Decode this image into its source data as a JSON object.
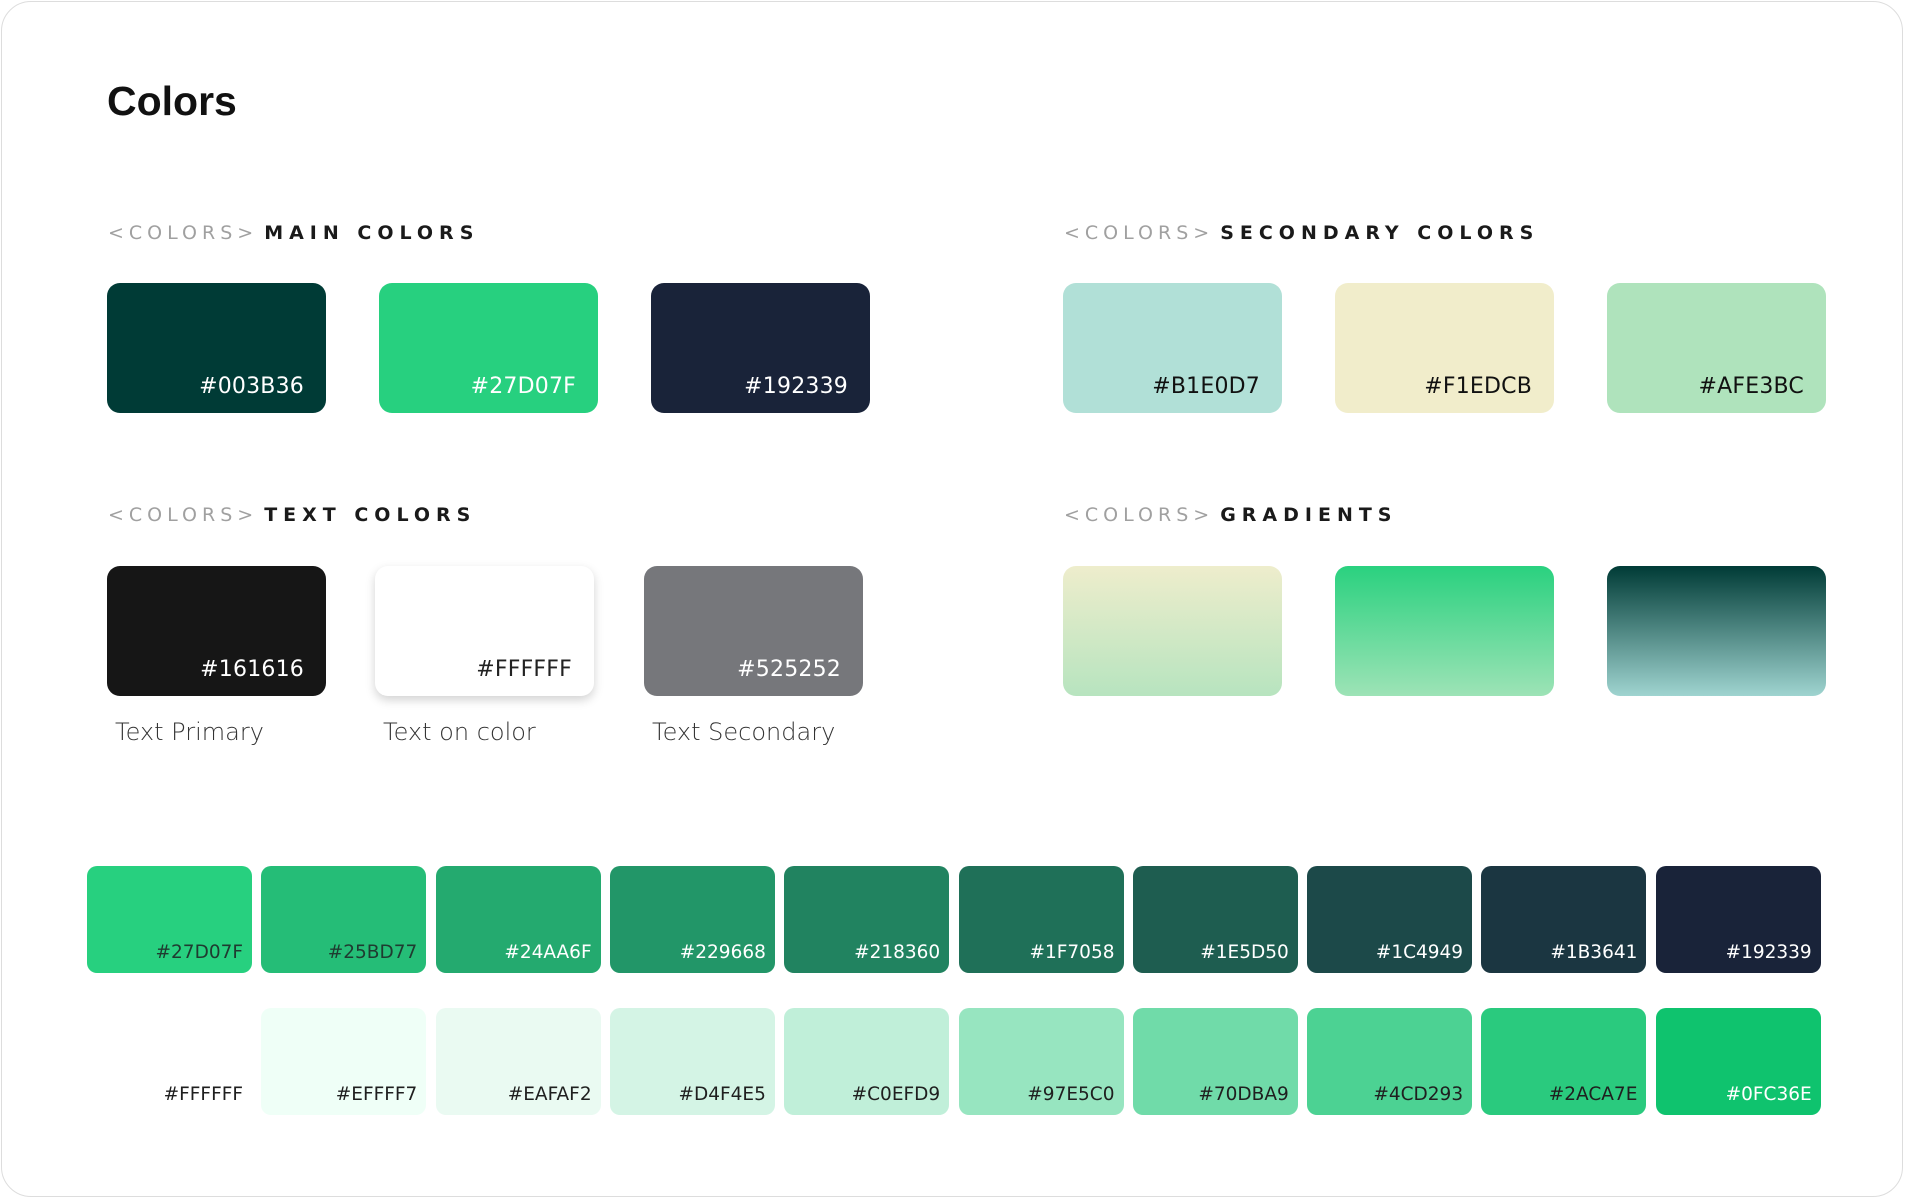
{
  "page": {
    "title": "Colors"
  },
  "main_colors": {
    "prefix": "<COLORS>",
    "title": "MAIN COLORS",
    "swatches": [
      {
        "hex": "#003B36",
        "color": "#003b36",
        "text_color": "#ffffff"
      },
      {
        "hex": "#27D07F",
        "color": "#27d07f",
        "text_color": "#ffffff"
      },
      {
        "hex": "#192339",
        "color": "#192339",
        "text_color": "#ffffff"
      }
    ]
  },
  "secondary_colors": {
    "prefix": "<COLORS>",
    "title": "SECONDARY COLORS",
    "swatches": [
      {
        "hex": "#B1E0D7",
        "color": "#b1e0d7",
        "text_color": "#111111"
      },
      {
        "hex": "#F1EDCB",
        "color": "#f1edcb",
        "text_color": "#111111"
      },
      {
        "hex": "#AFE3BC",
        "color": "#afe3bc",
        "text_color": "#111111"
      }
    ]
  },
  "text_colors": {
    "prefix": "<COLORS>",
    "title": "TEXT COLORS",
    "swatches": [
      {
        "hex": "#161616",
        "color": "#161616",
        "text_color": "#ffffff",
        "caption": "Text Primary"
      },
      {
        "hex": "#FFFFFF",
        "color": "#ffffff",
        "text_color": "#222222",
        "caption": "Text on color"
      },
      {
        "hex": "#525252",
        "color": "#76777b",
        "text_color": "#ffffff",
        "caption": "Text Secondary"
      }
    ]
  },
  "gradients": {
    "prefix": "<COLORS>",
    "title": "GRADIENTS",
    "items": [
      {
        "from": "#eeedcc",
        "to": "#b7e4bf"
      },
      {
        "from": "#2ad17f",
        "to": "#9de3b6"
      },
      {
        "from": "#003b36",
        "to": "#9fd4d0"
      }
    ]
  },
  "palette_dark": [
    {
      "hex": "#27D07F",
      "color": "#27d07f"
    },
    {
      "hex": "#25BD77",
      "color": "#25bd77"
    },
    {
      "hex": "#24AA6F",
      "color": "#24aa6f"
    },
    {
      "hex": "#229668",
      "color": "#229668"
    },
    {
      "hex": "#218360",
      "color": "#218360"
    },
    {
      "hex": "#1F7058",
      "color": "#1f7058"
    },
    {
      "hex": "#1E5D50",
      "color": "#1e5d50"
    },
    {
      "hex": "#1C4949",
      "color": "#1c4949"
    },
    {
      "hex": "#1B3641",
      "color": "#1b3641"
    },
    {
      "hex": "#192339",
      "color": "#192339"
    }
  ],
  "palette_light": [
    {
      "hex": "#FFFFFF",
      "color": "#ffffff"
    },
    {
      "hex": "#EFFFF7",
      "color": "#effff7"
    },
    {
      "hex": "#EAFAF2",
      "color": "#eafaf2"
    },
    {
      "hex": "#D4F4E5",
      "color": "#d4f4e5"
    },
    {
      "hex": "#C0EFD9",
      "color": "#c0efd9"
    },
    {
      "hex": "#97E5C0",
      "color": "#97e5c0"
    },
    {
      "hex": "#70DBA9",
      "color": "#70dba9"
    },
    {
      "hex": "#4CD293",
      "color": "#4cd293"
    },
    {
      "hex": "#2ACA7E",
      "color": "#2aca7e"
    },
    {
      "hex": "#0FC36E",
      "color": "#0fc36e"
    }
  ]
}
